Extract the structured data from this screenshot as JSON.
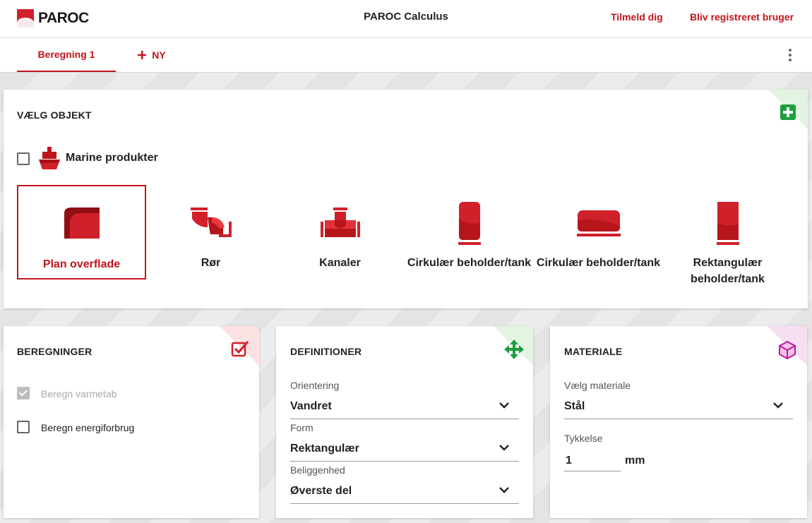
{
  "header": {
    "logo_text": "PAROC",
    "app_title": "PAROC Calculus",
    "login_link": "Tilmeld dig",
    "register_link": "Bliv registreret bruger"
  },
  "tabs": {
    "items": [
      {
        "label": "Beregning 1",
        "active": true
      },
      {
        "label": "NY",
        "active": false
      }
    ]
  },
  "select_object": {
    "title": "VÆLG OBJEKT",
    "marine_label": "Marine produkter",
    "marine_checked": false,
    "objects": [
      {
        "label": "Plan overflade",
        "selected": true
      },
      {
        "label": "Rør",
        "selected": false
      },
      {
        "label": "Kanaler",
        "selected": false
      },
      {
        "label": "Cirkulær beholder/tank",
        "selected": false
      },
      {
        "label": "Cirkulær beholder/tank",
        "selected": false
      },
      {
        "label": "Rektangulær beholder/tank",
        "selected": false
      }
    ]
  },
  "calculations": {
    "title": "BEREGNINGER",
    "options": [
      {
        "label": "Beregn varmetab",
        "checked": true,
        "disabled": true
      },
      {
        "label": "Beregn energiforbrug",
        "checked": false,
        "disabled": false
      }
    ]
  },
  "definitions": {
    "title": "DEFINITIONER",
    "fields": [
      {
        "label": "Orientering",
        "value": "Vandret"
      },
      {
        "label": "Form",
        "value": "Rektangulær"
      },
      {
        "label": "Beliggenhed",
        "value": "Øverste del"
      }
    ]
  },
  "material": {
    "title": "MATERIALE",
    "material_label": "Vælg materiale",
    "material_value": "Stål",
    "thickness_label": "Tykkelse",
    "thickness_value": "1",
    "thickness_unit": "mm"
  },
  "colors": {
    "brand_red": "#c0141b",
    "accent_green": "#1e9e3e",
    "accent_magenta": "#c0189c"
  },
  "icons": {
    "add": "plus-square-icon",
    "calc": "checkbox-check-icon",
    "definitions": "move-arrows-icon",
    "material": "cube-icon",
    "marine": "ship-icon"
  }
}
